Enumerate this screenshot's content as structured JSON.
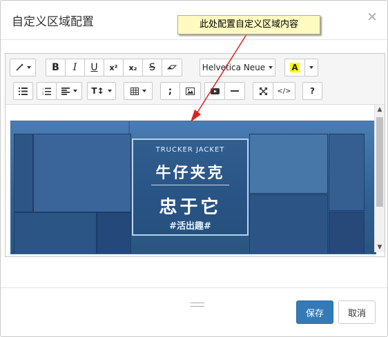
{
  "dialog": {
    "title": "自定义区域配置",
    "close_label": "×",
    "callout": "此处配置自定义区域内容"
  },
  "toolbar": {
    "font_name": "Helvetica Neue",
    "row1": [
      {
        "name": "magic-wand-style",
        "label": "",
        "icon": "magic-wand-icon"
      },
      {
        "name": "bold",
        "label": "B"
      },
      {
        "name": "italic",
        "label": "I"
      },
      {
        "name": "underline",
        "label": "U"
      },
      {
        "name": "superscript",
        "label": "x²"
      },
      {
        "name": "subscript",
        "label": "x₂"
      },
      {
        "name": "strikethrough",
        "label": "S"
      },
      {
        "name": "eraser",
        "label": "",
        "icon": "eraser-icon"
      }
    ],
    "color_letter": "A",
    "color_highlight": "#ffff00",
    "row2": [
      {
        "name": "unordered-list",
        "icon": "ul-icon"
      },
      {
        "name": "ordered-list",
        "icon": "ol-icon"
      },
      {
        "name": "align",
        "icon": "align-icon"
      },
      {
        "name": "line-height",
        "label": "T↕",
        "icon": "line-height-icon"
      },
      {
        "name": "table",
        "icon": "table-icon"
      },
      {
        "name": "special-char",
        "label": ";"
      },
      {
        "name": "image",
        "icon": "image-icon"
      },
      {
        "name": "video",
        "icon": "video-icon"
      },
      {
        "name": "horizontal-rule",
        "icon": "hr-icon"
      },
      {
        "name": "fullscreen",
        "icon": "expand-icon"
      },
      {
        "name": "code-view",
        "label": "</>"
      },
      {
        "name": "help",
        "label": "?"
      }
    ]
  },
  "banner": {
    "subtitle": "TRUCKER JACKET",
    "line1": "牛仔夹克",
    "line2": "忠于它",
    "tag": "#活出趣#"
  },
  "footer": {
    "save_label": "保存",
    "cancel_label": "取消"
  },
  "colors": {
    "primary": "#337ab7",
    "callout_bg": "#fefac0",
    "arrow": "#e02020"
  }
}
